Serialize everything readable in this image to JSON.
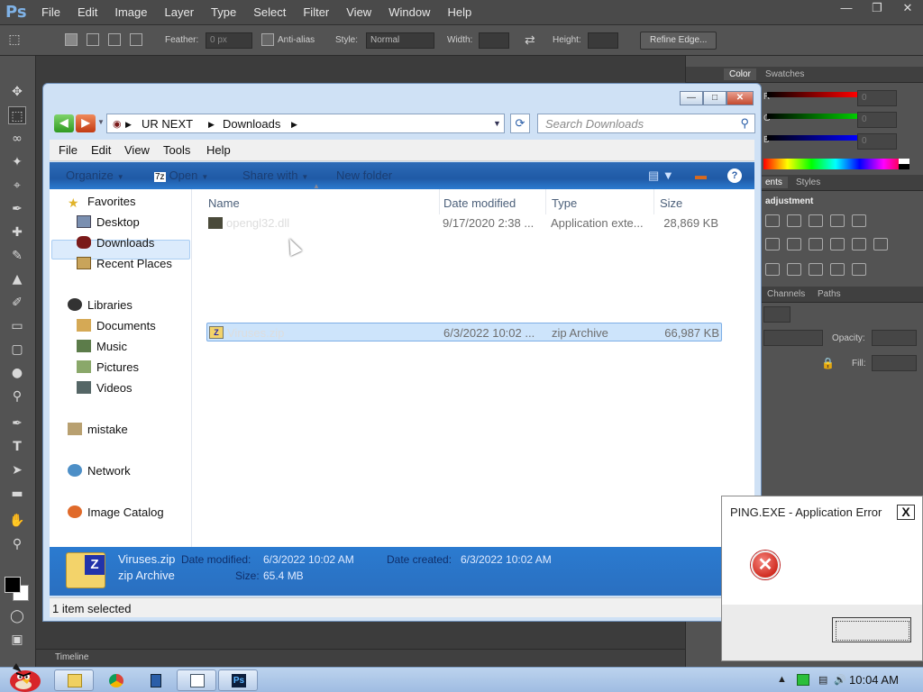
{
  "photoshop": {
    "logo": "Ps",
    "menu": [
      "File",
      "Edit",
      "Image",
      "Layer",
      "Type",
      "Select",
      "Filter",
      "View",
      "Window",
      "Help"
    ],
    "options": {
      "feather_label": "Feather:",
      "feather_value": "0 px",
      "antialias_label": "Anti-alias",
      "style_label": "Style:",
      "style_value": "Normal",
      "width_label": "Width:",
      "height_label": "Height:",
      "refine_edge": "Refine Edge..."
    },
    "panels": {
      "color_tab": "Color",
      "swatches_tab": "Swatches",
      "adjustments_tab": "ents",
      "styles_tab": "Styles",
      "adjustment_heading": "adjustment",
      "channels_tab": "Channels",
      "paths_tab": "Paths",
      "opacity_label": "Opacity:",
      "fill_label": "Fill:",
      "channel_letters": [
        "R",
        "G",
        "B"
      ],
      "color_values": [
        "0",
        "0",
        "0"
      ]
    },
    "timeline": "Timeline"
  },
  "explorer": {
    "breadcrumb": [
      "UR NEXT",
      "Downloads"
    ],
    "search_placeholder": "Search Downloads",
    "menu": [
      "File",
      "Edit",
      "View",
      "Tools",
      "Help"
    ],
    "commands": {
      "organize": "Organize",
      "open": "Open",
      "share_with": "Share with",
      "new_folder": "New folder"
    },
    "nav": {
      "favorites": "Favorites",
      "desktop": "Desktop",
      "downloads": "Downloads",
      "recent_places": "Recent Places",
      "libraries": "Libraries",
      "documents": "Documents",
      "music": "Music",
      "pictures": "Pictures",
      "videos": "Videos",
      "mistake": "mistake",
      "network": "Network",
      "image_catalog": "Image Catalog"
    },
    "columns": [
      "Name",
      "Date modified",
      "Type",
      "Size"
    ],
    "files": [
      {
        "name": "opengl32.dll",
        "date": "9/17/2020 2:38 ...",
        "type": "Application exte...",
        "size": "28,869 KB"
      },
      {
        "name": "Viruses.zip",
        "date": "6/3/2022 10:02 ...",
        "type": "zip Archive",
        "size": "66,987 KB"
      }
    ],
    "details": {
      "name": "Viruses.zip",
      "kind": "zip Archive",
      "date_modified_label": "Date modified:",
      "date_modified": "6/3/2022 10:02 AM",
      "date_created_label": "Date created:",
      "date_created": "6/3/2022 10:02 AM",
      "size_label": "Size:",
      "size": "65.4 MB"
    },
    "status": "1 item selected"
  },
  "error_dialog": {
    "title": "PING.EXE - Application Error",
    "close": "X",
    "icon": "error-x-icon",
    "ok_label": ""
  },
  "taskbar": {
    "clock": "10:04 AM"
  }
}
